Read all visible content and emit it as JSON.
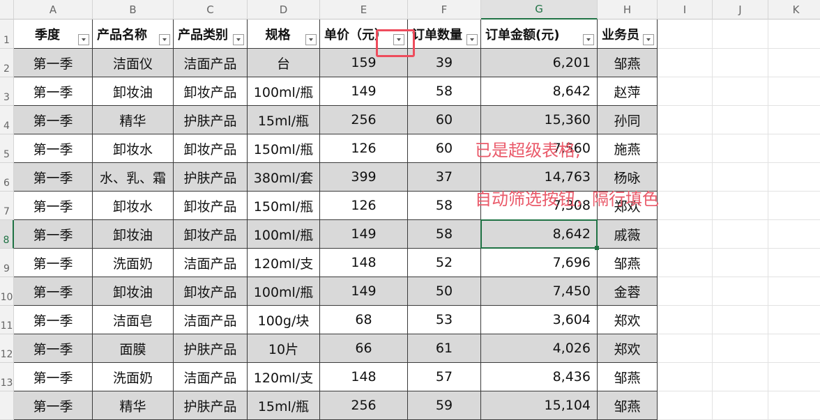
{
  "spreadsheet": {
    "column_letters": [
      "A",
      "B",
      "C",
      "D",
      "E",
      "F",
      "G",
      "H",
      "I",
      "J",
      "K"
    ],
    "row_numbers": [
      "1",
      "2",
      "3",
      "4",
      "5",
      "6",
      "7",
      "8",
      "9",
      "10",
      "11",
      "12",
      "13",
      ""
    ],
    "selected_column": "G",
    "selected_row": "8",
    "headers": [
      "季度",
      "产品名称",
      "产品类别",
      "规格",
      "单价（元）",
      "订单数量",
      "订单金额(元)",
      "业务员"
    ],
    "rows": [
      [
        "第一季",
        "洁面仪",
        "洁面产品",
        "台",
        "159",
        "39",
        "6,201",
        "邹燕"
      ],
      [
        "第一季",
        "卸妆油",
        "卸妆产品",
        "100ml/瓶",
        "149",
        "58",
        "8,642",
        "赵萍"
      ],
      [
        "第一季",
        "精华",
        "护肤产品",
        "15ml/瓶",
        "256",
        "60",
        "15,360",
        "孙同"
      ],
      [
        "第一季",
        "卸妆水",
        "卸妆产品",
        "150ml/瓶",
        "126",
        "60",
        "7,560",
        "施燕"
      ],
      [
        "第一季",
        "水、乳、霜",
        "护肤产品",
        "380ml/套",
        "399",
        "37",
        "14,763",
        "杨咏"
      ],
      [
        "第一季",
        "卸妆水",
        "卸妆产品",
        "150ml/瓶",
        "126",
        "58",
        "7,308",
        "郑欢"
      ],
      [
        "第一季",
        "卸妆油",
        "卸妆产品",
        "100ml/瓶",
        "149",
        "58",
        "8,642",
        "戚薇"
      ],
      [
        "第一季",
        "洗面奶",
        "洁面产品",
        "120ml/支",
        "148",
        "52",
        "7,696",
        "邹燕"
      ],
      [
        "第一季",
        "卸妆油",
        "卸妆产品",
        "100ml/瓶",
        "149",
        "50",
        "7,450",
        "金蓉"
      ],
      [
        "第一季",
        "洁面皂",
        "洁面产品",
        "100g/块",
        "68",
        "53",
        "3,604",
        "郑欢"
      ],
      [
        "第一季",
        "面膜",
        "护肤产品",
        "10片",
        "66",
        "61",
        "4,026",
        "郑欢"
      ],
      [
        "第一季",
        "洗面奶",
        "洁面产品",
        "120ml/支",
        "148",
        "57",
        "8,436",
        "邹燕"
      ],
      [
        "第一季",
        "精华",
        "护肤产品",
        "15ml/瓶",
        "256",
        "59",
        "15,104",
        "邹燕"
      ]
    ]
  },
  "annotations": {
    "line1": "已是超级表格,",
    "line2": "自动筛选按钮，隔行填色",
    "color": "#ea5a6a"
  },
  "colors": {
    "band_fill": "#d9d9d9",
    "selection_green": "#1f7244"
  }
}
